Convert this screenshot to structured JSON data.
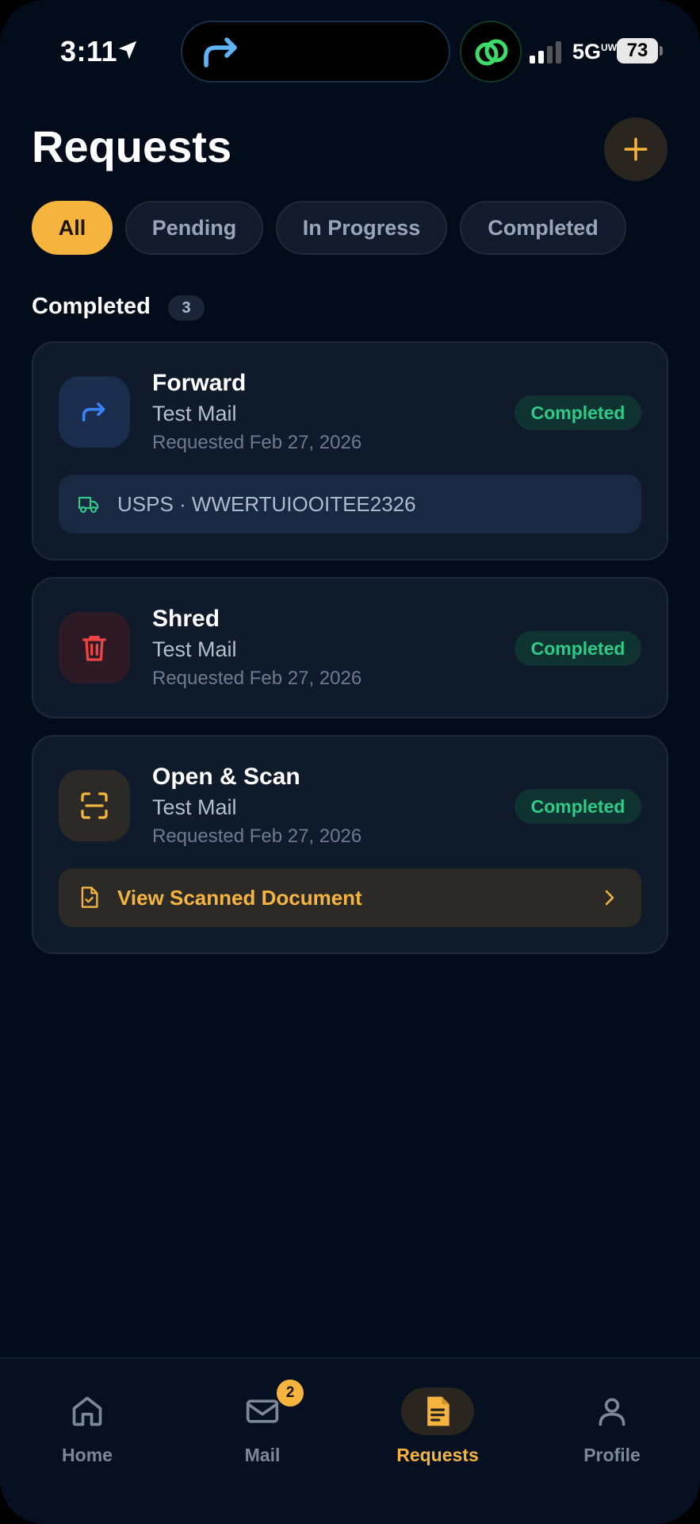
{
  "status_bar": {
    "time": "3:11",
    "network": "5G",
    "network_sup": "UW",
    "battery": "73"
  },
  "header": {
    "title": "Requests"
  },
  "tabs": [
    {
      "label": "All",
      "active": true
    },
    {
      "label": "Pending",
      "active": false
    },
    {
      "label": "In Progress",
      "active": false
    },
    {
      "label": "Completed",
      "active": false
    }
  ],
  "section": {
    "title": "Completed",
    "count": "3"
  },
  "requests": [
    {
      "type": "Forward",
      "mail": "Test Mail",
      "date": "Requested Feb 27, 2026",
      "status": "Completed",
      "icon": "forward-arrow-icon",
      "tracking": "USPS · WWERTUIOOITEE2326"
    },
    {
      "type": "Shred",
      "mail": "Test Mail",
      "date": "Requested Feb 27, 2026",
      "status": "Completed",
      "icon": "trash-icon"
    },
    {
      "type": "Open & Scan",
      "mail": "Test Mail",
      "date": "Requested Feb 27, 2026",
      "status": "Completed",
      "icon": "scan-icon",
      "action": "View Scanned Document"
    }
  ],
  "bottom_nav": [
    {
      "label": "Home",
      "icon": "home-icon"
    },
    {
      "label": "Mail",
      "icon": "mail-icon",
      "badge": "2"
    },
    {
      "label": "Requests",
      "icon": "document-icon",
      "active": true
    },
    {
      "label": "Profile",
      "icon": "person-icon"
    }
  ],
  "colors": {
    "background": "#030c1a",
    "card": "#0f1a2b",
    "accent": "#f5b43e",
    "success": "#2fc98a",
    "forward": "#3b82f6",
    "shred": "#ef4444"
  }
}
